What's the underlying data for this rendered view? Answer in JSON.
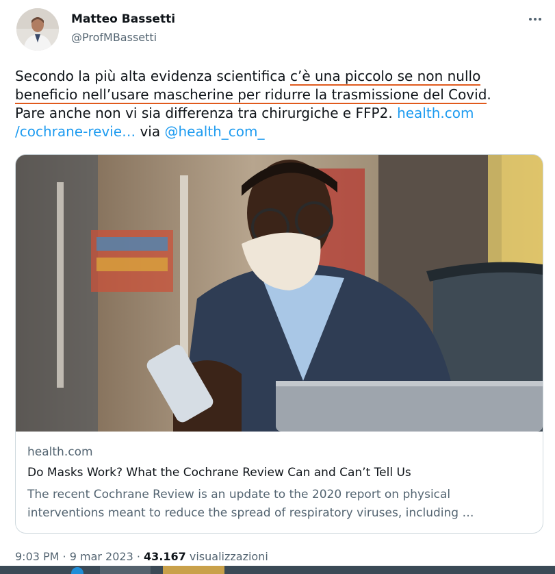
{
  "author": {
    "name": "Matteo Bassetti",
    "handle": "@ProfMBassetti"
  },
  "tweet": {
    "line1_a": "Secondo la più alta evidenza scientifica ",
    "line1_b": "c’è una piccolo se non nullo",
    "line2_a": "beneficio nell’usare mascherine per ridurre la trasmissione del Covid",
    "line2_b": ".",
    "line3_a": "Pare anche non vi sia differenza tra chirurgiche e FFP2. ",
    "line3_link": "health.com",
    "line4_link": "/cochrane-revie…",
    "line4_via": " via ",
    "line4_mention": "@health_com_"
  },
  "card": {
    "domain": "health.com",
    "title": "Do Masks Work? What the Cochrane Review Can and Can’t Tell Us",
    "description_line1": "The recent Cochrane Review is an update to the 2020 report on physical",
    "description_line2": "interventions meant to reduce the spread of respiratory viruses, including …"
  },
  "meta": {
    "time": "9:03 PM",
    "sep1": " · ",
    "date": "9 mar 2023",
    "sep2": " · ",
    "views": "43.167",
    "views_label": " visualizzazioni"
  },
  "icons": {
    "more": "more-horizontal-icon"
  },
  "colors": {
    "link": "#1d9bf0",
    "underline": "#e05a1c",
    "secondary_text": "#536471"
  }
}
